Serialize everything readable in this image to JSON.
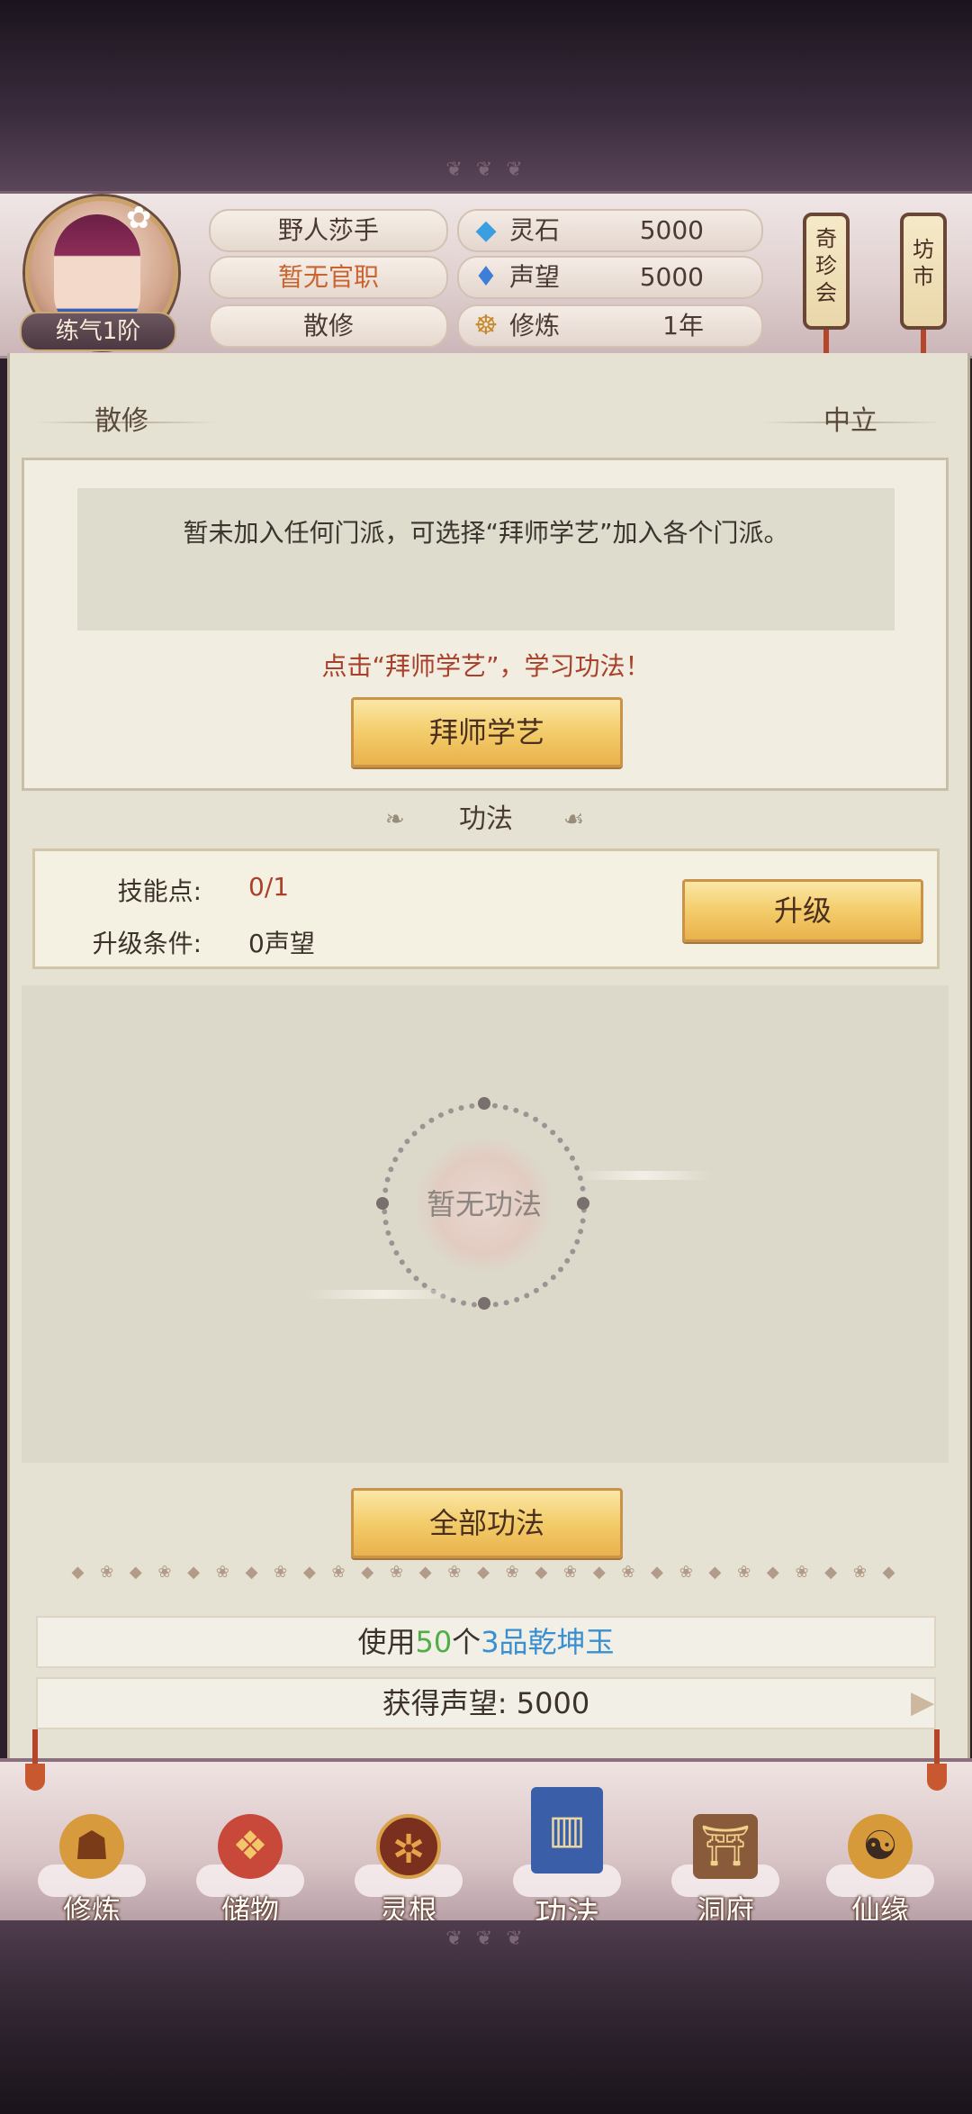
{
  "player": {
    "name": "野人莎手",
    "official_title": "暂无官职",
    "faction": "散修",
    "rank": "练气1阶"
  },
  "resources": [
    {
      "icon": "spirit-stone-icon",
      "label": "灵石",
      "value": "5000"
    },
    {
      "icon": "reputation-icon",
      "label": "声望",
      "value": "5000"
    },
    {
      "icon": "cultivation-icon",
      "label": "修炼",
      "value": "1年"
    }
  ],
  "side_buttons": {
    "qizhen": "奇\n珍\n会",
    "market": "坊\n市"
  },
  "sect": {
    "left_tag": "散修",
    "right_tag": "中立",
    "notice": "暂未加入任何门派，可选择“拜师学艺”加入各个门派。",
    "hint": "点击“拜师学艺”，学习功法！",
    "join_button": "拜师学艺"
  },
  "skills": {
    "section_title": "功法",
    "skill_points_label": "技能点:",
    "skill_points_value": "0/1",
    "upgrade_condition_label": "升级条件:",
    "upgrade_condition_value": "0声望",
    "upgrade_button": "升级",
    "empty_text": "暂无功法",
    "all_button": "全部功法"
  },
  "offer": {
    "prefix": "使用",
    "count": "50",
    "measure": "个",
    "item": "3品乾坤玉",
    "reward": "获得声望: 5000"
  },
  "nav": [
    {
      "icon": "hooded-cultivator-icon",
      "label": "修炼"
    },
    {
      "icon": "treasure-bag-icon",
      "label": "储物"
    },
    {
      "icon": "spirit-root-icon",
      "label": "灵根"
    },
    {
      "icon": "scripture-book-icon",
      "label": "功法"
    },
    {
      "icon": "cave-mansion-icon",
      "label": "洞府"
    },
    {
      "icon": "gourd-icon",
      "label": "仙缘"
    }
  ],
  "colors": {
    "accent_red": "#a8402a",
    "count_green": "#4fae44",
    "item_blue": "#3a8fd0",
    "gold_button": "#f3cc6a"
  }
}
